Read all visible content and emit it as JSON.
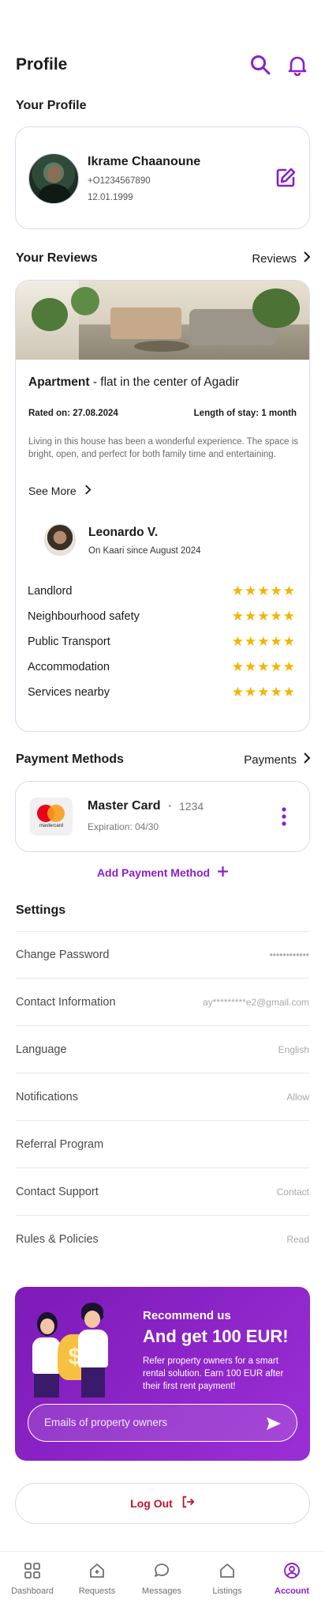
{
  "header": {
    "title": "Profile"
  },
  "profile": {
    "section_title": "Your Profile",
    "name": "Ikrame Chaanoune",
    "phone": "+O1234567890",
    "birthdate": "12.01.1999"
  },
  "reviews": {
    "section_title": "Your Reviews",
    "link_label": "Reviews",
    "property_type": "Apartment",
    "property_desc": " - flat in the center of Agadir",
    "rated_on": "Rated on: 27.08.2024",
    "stay_length": "Length of stay: 1 month",
    "body": "Living in this house has been a wonderful experience. The space is bright, open, and perfect for both family time and entertaining.",
    "see_more": "See More",
    "reviewer_name": "Leonardo V.",
    "reviewer_since": "On Kaari since August 2024",
    "ratings": [
      {
        "label": "Landlord",
        "stars": 5
      },
      {
        "label": "Neighbourhood safety",
        "stars": 5
      },
      {
        "label": "Public Transport",
        "stars": 5
      },
      {
        "label": "Accommodation",
        "stars": 5
      },
      {
        "label": "Services nearby",
        "stars": 5
      }
    ]
  },
  "payments": {
    "section_title": "Payment Methods",
    "link_label": "Payments",
    "card_name": "Master Card",
    "card_dot": "•",
    "card_last4": "1234",
    "card_expiry": "Expiration: 04/30",
    "card_logo_text": "mastercard",
    "add_label": "Add Payment Method"
  },
  "settings": {
    "section_title": "Settings",
    "items": [
      {
        "label": "Change Password",
        "value": "••••••••••••"
      },
      {
        "label": "Contact Information",
        "value": "ay*********e2@gmail.com"
      },
      {
        "label": "Language",
        "value": "English"
      },
      {
        "label": "Notifications",
        "value": "Allow"
      },
      {
        "label": "Referral Program",
        "value": ""
      },
      {
        "label": "Contact Support",
        "value": "Contact"
      },
      {
        "label": "Rules & Policies",
        "value": "Read"
      }
    ]
  },
  "promo": {
    "eyebrow": "Recommend us",
    "headline": "And get 100 EUR!",
    "body": "Refer property owners for a smart rental solution. Earn 100 EUR after their first rent payment!",
    "input_placeholder": "Emails of property owners",
    "coin_symbol": "$"
  },
  "logout": {
    "label": "Log Out"
  },
  "bottom_nav": {
    "items": [
      {
        "label": "Dashboard",
        "icon": "grid-icon"
      },
      {
        "label": "Requests",
        "icon": "house-request-icon"
      },
      {
        "label": "Messages",
        "icon": "chat-icon"
      },
      {
        "label": "Listings",
        "icon": "home-icon"
      },
      {
        "label": "Account",
        "icon": "user-circle-icon",
        "active": true
      }
    ]
  },
  "colors": {
    "accent": "#8a1fc9",
    "star": "#f5b400",
    "logout": "#c0122b"
  }
}
